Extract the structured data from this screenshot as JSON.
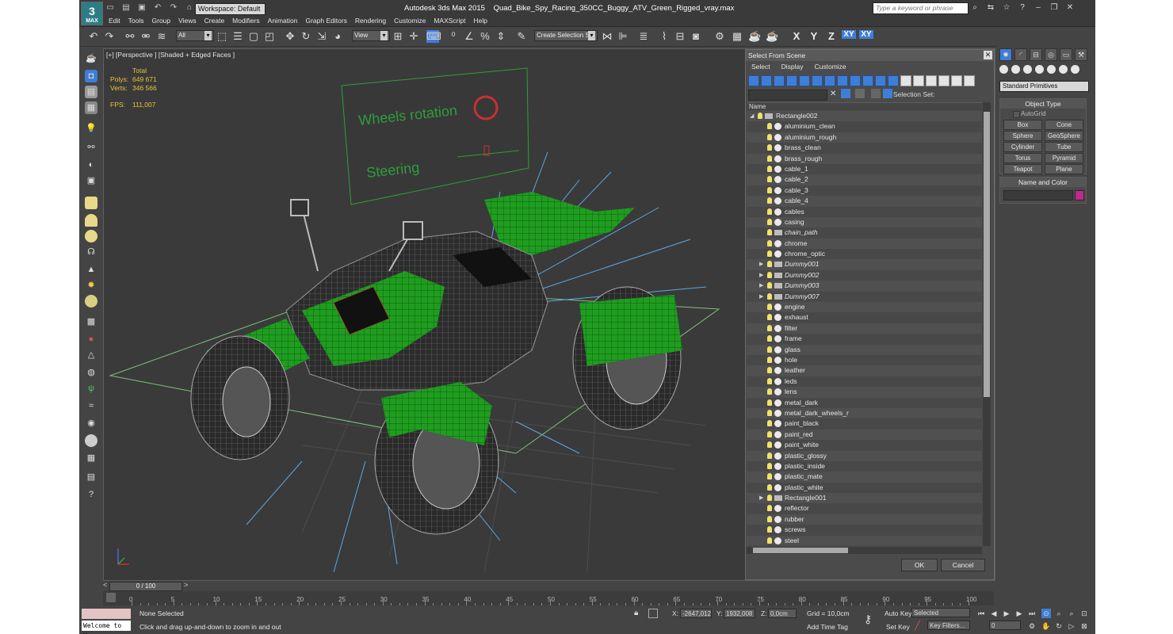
{
  "titlebar": {
    "workspace": "Workspace: Default",
    "app_name": "Autodesk 3ds Max  2015",
    "file_name": "Quad_Bike_Spy_Racing_350CC_Buggy_ATV_Green_Rigged_vray.max",
    "search_placeholder": "Type a keyword or phrase"
  },
  "menu": [
    "Edit",
    "Tools",
    "Group",
    "Views",
    "Create",
    "Modifiers",
    "Animation",
    "Graph Editors",
    "Rendering",
    "Customize",
    "MAXScript",
    "Help"
  ],
  "toolbar": {
    "filter": "All",
    "coord": "View",
    "selection_set": "Create Selection Se",
    "axes": [
      "X",
      "Y",
      "Z",
      "XY",
      "XY"
    ]
  },
  "viewport": {
    "label": "[+] [Perspective ] [Shaded + Edged Faces ]",
    "stats": {
      "total_label": "Total",
      "polys_label": "Polys:",
      "polys": "649 671",
      "verts_label": "Verts:",
      "verts": "346 566",
      "fps_label": "FPS:",
      "fps": "111,007"
    },
    "hud_wheels": "Wheels rotation",
    "hud_steering": "Steering"
  },
  "dialog": {
    "title": "Select From Scene",
    "menu": [
      "Select",
      "Display",
      "Customize"
    ],
    "selection_set_label": "Selection Set:",
    "column": "Name",
    "root": "Rectangle002",
    "items": [
      {
        "label": "aluminium_clean",
        "kind": "mesh"
      },
      {
        "label": "aluminium_rough",
        "kind": "mesh"
      },
      {
        "label": "brass_clean",
        "kind": "mesh"
      },
      {
        "label": "brass_rough",
        "kind": "mesh"
      },
      {
        "label": "cable_1",
        "kind": "mesh"
      },
      {
        "label": "cable_2",
        "kind": "mesh"
      },
      {
        "label": "cable_3",
        "kind": "mesh"
      },
      {
        "label": "cable_4",
        "kind": "mesh"
      },
      {
        "label": "cables",
        "kind": "mesh"
      },
      {
        "label": "casing",
        "kind": "mesh"
      },
      {
        "label": "chain_path",
        "kind": "shape"
      },
      {
        "label": "chrome",
        "kind": "mesh"
      },
      {
        "label": "chrome_optic",
        "kind": "mesh"
      },
      {
        "label": "Dummy001",
        "kind": "dummy"
      },
      {
        "label": "Dummy002",
        "kind": "dummy"
      },
      {
        "label": "Dummy003",
        "kind": "dummy"
      },
      {
        "label": "Dummy007",
        "kind": "dummy"
      },
      {
        "label": "engine",
        "kind": "mesh"
      },
      {
        "label": "exhaust",
        "kind": "mesh"
      },
      {
        "label": "filter",
        "kind": "mesh"
      },
      {
        "label": "frame",
        "kind": "mesh"
      },
      {
        "label": "glass",
        "kind": "mesh"
      },
      {
        "label": "hole",
        "kind": "mesh"
      },
      {
        "label": "leather",
        "kind": "mesh"
      },
      {
        "label": "leds",
        "kind": "mesh"
      },
      {
        "label": "lens",
        "kind": "mesh"
      },
      {
        "label": "metal_dark",
        "kind": "mesh"
      },
      {
        "label": "metal_dark_wheels_r",
        "kind": "mesh"
      },
      {
        "label": "paint_black",
        "kind": "mesh"
      },
      {
        "label": "paint_red",
        "kind": "mesh"
      },
      {
        "label": "paint_white",
        "kind": "mesh"
      },
      {
        "label": "plastic_glossy",
        "kind": "mesh"
      },
      {
        "label": "plastic_inside",
        "kind": "mesh"
      },
      {
        "label": "plastic_mate",
        "kind": "mesh"
      },
      {
        "label": "plastic_white",
        "kind": "mesh"
      },
      {
        "label": "Rectangle001",
        "kind": "group"
      },
      {
        "label": "reflector",
        "kind": "mesh"
      },
      {
        "label": "rubber",
        "kind": "mesh"
      },
      {
        "label": "screws",
        "kind": "mesh"
      },
      {
        "label": "steel",
        "kind": "mesh"
      }
    ],
    "ok": "OK",
    "cancel": "Cancel"
  },
  "command_panel": {
    "category": "Standard Primitives",
    "object_type_title": "Object Type",
    "autogrid": "AutoGrid",
    "buttons": [
      "Box",
      "Cone",
      "Sphere",
      "GeoSphere",
      "Cylinder",
      "Tube",
      "Torus",
      "Pyramid",
      "Teapot",
      "Plane"
    ],
    "name_color_title": "Name and Color",
    "color": "#c0288a"
  },
  "timeline": {
    "slider": "0 / 100",
    "ticks": [
      "0",
      "5",
      "10",
      "15",
      "20",
      "25",
      "30",
      "35",
      "40",
      "45",
      "50",
      "55",
      "60",
      "65",
      "70",
      "75",
      "80",
      "85",
      "90",
      "95",
      "100"
    ]
  },
  "status": {
    "welcome": "Welcome to M:",
    "selection": "None Selected",
    "prompt": "Click and drag up-and-down to zoom in and out",
    "x_label": "X:",
    "x": "-2647,012",
    "y_label": "Y:",
    "y": "1932,008",
    "z_label": "Z:",
    "z": "0,0cm",
    "grid": "Grid = 10,0cm",
    "add_time_tag": "Add Time Tag",
    "auto_key": "Auto Key",
    "set_key": "Set Key",
    "key_mode": "Selected",
    "key_filters": "Key Filters...",
    "frame": "0"
  },
  "colors": {
    "accent": "#3f7ed8",
    "model_green": "#1f9d1f",
    "stats_yellow": "#e8c53a",
    "hud_green": "#2e9e3a"
  }
}
